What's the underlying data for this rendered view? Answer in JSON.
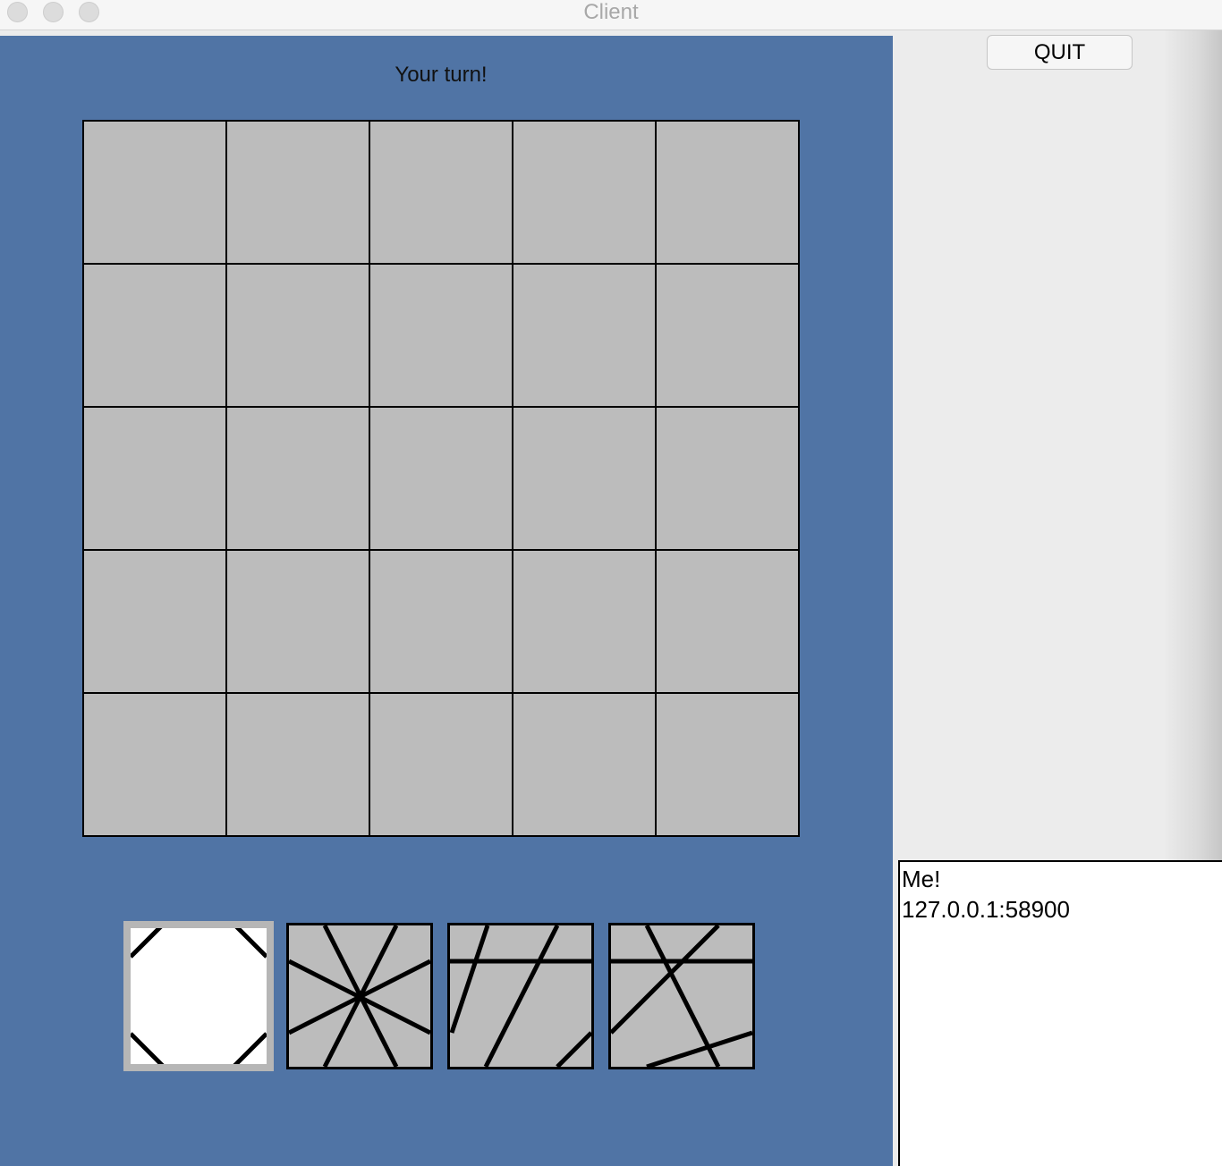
{
  "window": {
    "title": "Client"
  },
  "game": {
    "status": "Your turn!",
    "board": {
      "rows": 5,
      "cols": 5
    },
    "colors": {
      "panel": "#5074a5",
      "cell": "#bcbcbc",
      "selected_tile": "#ffffff"
    },
    "hand": [
      {
        "name": "corner-cuts-tile",
        "selected": true
      },
      {
        "name": "star-lines-tile",
        "selected": false
      },
      {
        "name": "slanted-lines-tile",
        "selected": false
      },
      {
        "name": "crossed-lines-tile",
        "selected": false
      }
    ]
  },
  "controls": {
    "quit_label": "QUIT"
  },
  "log": {
    "lines": [
      "Me!",
      "127.0.0.1:58900"
    ]
  }
}
